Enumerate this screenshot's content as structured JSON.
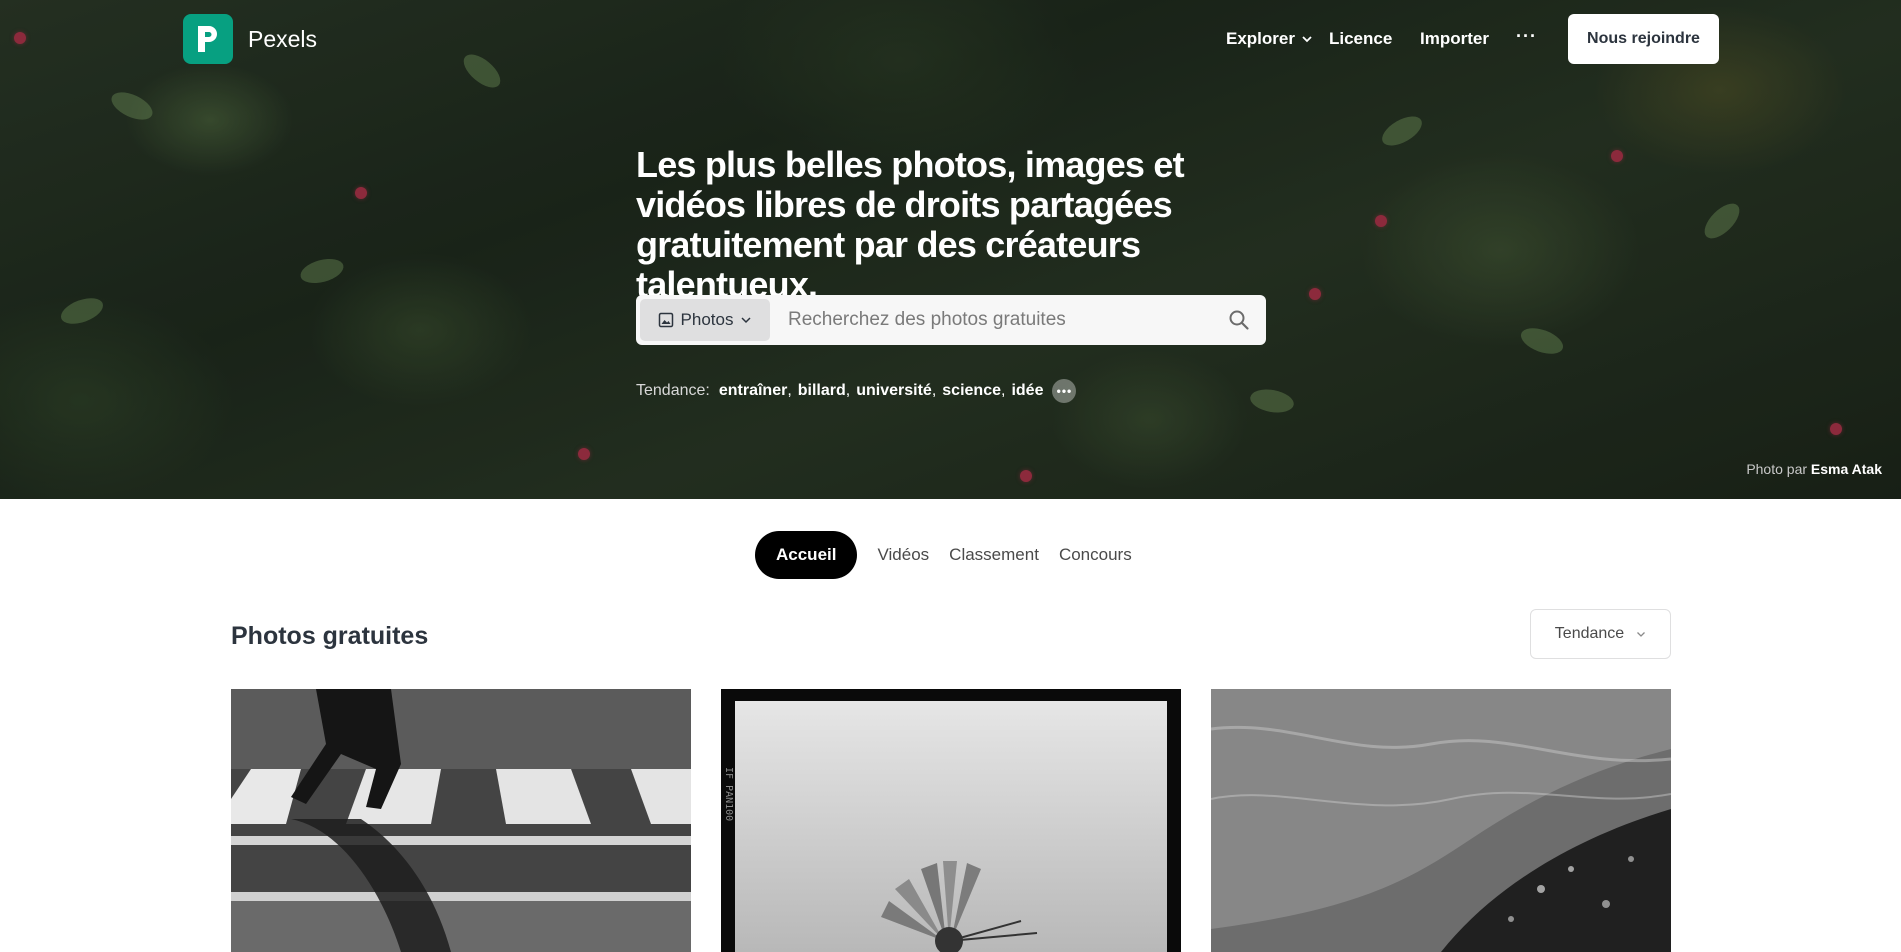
{
  "brand": {
    "name": "Pexels",
    "color": "#07a081"
  },
  "nav": {
    "explore": "Explorer",
    "license": "Licence",
    "upload": "Importer",
    "more": "···",
    "join": "Nous rejoindre"
  },
  "hero": {
    "headline": "Les plus belles photos, images et vidéos libres de droits partagées gratuitement par des créateurs talentueux.",
    "search": {
      "type_label": "Photos",
      "placeholder": "Recherchez des photos gratuites"
    },
    "trending": {
      "label": "Tendance:",
      "items": [
        "entraîner",
        "billard",
        "université",
        "science",
        "idée"
      ]
    },
    "credit": {
      "prefix": "Photo par",
      "author": "Esma Atak"
    }
  },
  "tabs": [
    {
      "label": "Accueil",
      "active": true
    },
    {
      "label": "Vidéos",
      "active": false
    },
    {
      "label": "Classement",
      "active": false
    },
    {
      "label": "Concours",
      "active": false
    }
  ],
  "section": {
    "title": "Photos gratuites",
    "sort": "Tendance"
  },
  "photos": [
    {
      "subject": "crosswalk-pedestrian",
      "film_text": ""
    },
    {
      "subject": "windmill-film-frame",
      "film_text": "IF PAN100"
    },
    {
      "subject": "water-surface",
      "film_text": ""
    }
  ]
}
